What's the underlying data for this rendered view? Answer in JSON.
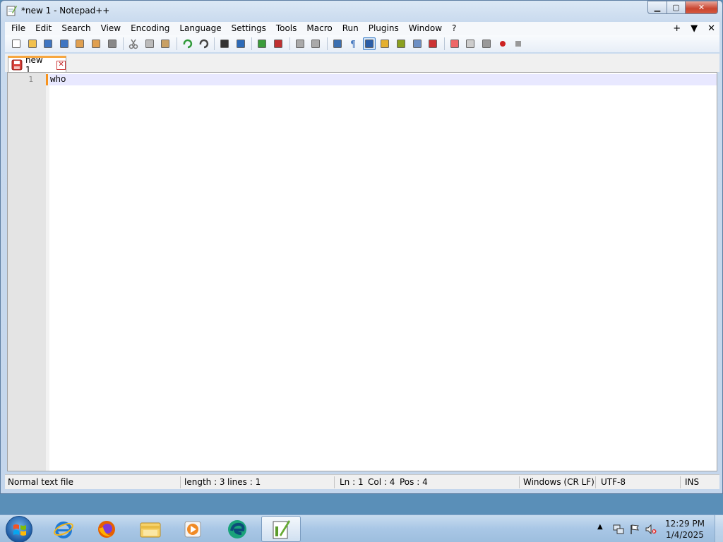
{
  "window": {
    "title": "*new 1 - Notepad++"
  },
  "menu": {
    "items": [
      "File",
      "Edit",
      "Search",
      "View",
      "Encoding",
      "Language",
      "Settings",
      "Tools",
      "Macro",
      "Run",
      "Plugins",
      "Window",
      "?"
    ],
    "right": [
      "+",
      "▼",
      "✕"
    ]
  },
  "tabs": [
    {
      "label": "new 1"
    }
  ],
  "editor": {
    "line_number": "1",
    "text": "who"
  },
  "status": {
    "file_type": "Normal text file",
    "length": "length : 3",
    "lines": "lines : 1",
    "ln": "Ln : 1",
    "col": "Col : 4",
    "pos": "Pos : 4",
    "eol": "Windows (CR LF)",
    "encoding": "UTF-8",
    "mode": "INS"
  },
  "taskbar": {
    "time": "12:29 PM",
    "date": "1/4/2025"
  },
  "toolbar_icons": [
    "new-file-icon",
    "open-file-icon",
    "save-icon",
    "save-all-icon",
    "close-icon",
    "close-all-icon",
    "print-icon",
    "cut-icon",
    "copy-icon",
    "paste-icon",
    "undo-icon",
    "redo-icon",
    "find-icon",
    "replace-icon",
    "zoom-in-icon",
    "zoom-out-icon",
    "sync-v-icon",
    "sync-h-icon",
    "word-wrap-icon",
    "show-all-chars-icon",
    "indent-guide-icon",
    "user-lang-icon",
    "doc-map-icon",
    "function-list-icon",
    "folder-workspace-icon",
    "monitor-icon",
    "bookmark-icon",
    "balloon-icon",
    "record-macro-icon",
    "stop-macro-icon",
    "play-macro-icon",
    "run-macro-multiple-icon",
    "save-macro-icon"
  ]
}
